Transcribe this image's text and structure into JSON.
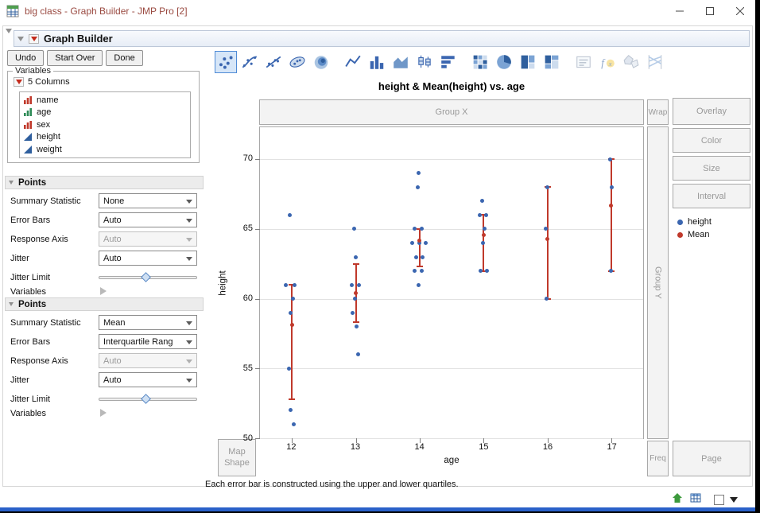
{
  "window": {
    "title": "big class - Graph Builder - JMP Pro [2]"
  },
  "report": {
    "header_title": "Graph Builder",
    "action_buttons": [
      "Undo",
      "Start Over",
      "Done"
    ]
  },
  "variables_panel": {
    "legend": "Variables",
    "columns_label": "5 Columns",
    "columns": [
      {
        "name": "name",
        "type": "nominal"
      },
      {
        "name": "age",
        "type": "ordinal"
      },
      {
        "name": "sex",
        "type": "nominal"
      },
      {
        "name": "height",
        "type": "continuous"
      },
      {
        "name": "weight",
        "type": "continuous"
      }
    ]
  },
  "field_labels": {
    "summary_statistic": "Summary Statistic",
    "error_bars": "Error Bars",
    "response_axis": "Response Axis",
    "jitter": "Jitter",
    "jitter_limit": "Jitter Limit",
    "variables": "Variables"
  },
  "points_panels": [
    {
      "title": "Points",
      "summary_statistic": "None",
      "error_bars": "Auto",
      "response_axis": "Auto",
      "jitter": "Auto"
    },
    {
      "title": "Points",
      "summary_statistic": "Mean",
      "error_bars": "Interquartile Rang",
      "response_axis": "Auto",
      "jitter": "Auto"
    }
  ],
  "toolbar_icons": [
    {
      "name": "points",
      "selected": true
    },
    {
      "name": "smoother"
    },
    {
      "name": "line-of-fit"
    },
    {
      "name": "ellipse"
    },
    {
      "name": "contour"
    },
    {
      "name": "line",
      "group": 2
    },
    {
      "name": "bar"
    },
    {
      "name": "area"
    },
    {
      "name": "box-plot"
    },
    {
      "name": "histogram"
    },
    {
      "name": "heatmap",
      "group": 3
    },
    {
      "name": "pie"
    },
    {
      "name": "treemap"
    },
    {
      "name": "mosaic"
    },
    {
      "name": "caption-box",
      "group": 4,
      "muted": true
    },
    {
      "name": "formula",
      "muted": true
    },
    {
      "name": "map-shapes",
      "muted": true
    },
    {
      "name": "parallel",
      "muted": true
    }
  ],
  "drop_zones": {
    "group_x": "Group X",
    "wrap": "Wrap",
    "overlay": "Overlay",
    "color": "Color",
    "size": "Size",
    "interval": "Interval",
    "group_y": "Group Y",
    "map_shape_line1": "Map",
    "map_shape_line2": "Shape",
    "freq": "Freq",
    "page": "Page"
  },
  "legend": {
    "items": [
      {
        "label": "height",
        "color": "#3b66b0"
      },
      {
        "label": "Mean",
        "color": "#c0392b"
      }
    ]
  },
  "chart_data": {
    "type": "scatter",
    "title": "height & Mean(height) vs. age",
    "xlabel": "age",
    "ylabel": "height",
    "x_categories": [
      "12",
      "13",
      "14",
      "15",
      "16",
      "17"
    ],
    "y_ticks": [
      50,
      55,
      60,
      65,
      70
    ],
    "ylim": [
      50,
      72.3
    ],
    "grid": "horizontal",
    "legend_position": "right",
    "series": [
      {
        "name": "height",
        "marker": "circle",
        "color": "#3b66b0",
        "points_by_age": {
          "12": [
            [
              66,
              -3
            ],
            [
              61,
              -8
            ],
            [
              61,
              3
            ],
            [
              60,
              1
            ],
            [
              59,
              -2
            ],
            [
              55,
              -4
            ],
            [
              52,
              -2
            ],
            [
              51,
              2
            ]
          ],
          "13": [
            [
              65,
              -2
            ],
            [
              63,
              0
            ],
            [
              61,
              4
            ],
            [
              61,
              -5
            ],
            [
              60,
              -1
            ],
            [
              59,
              -4
            ],
            [
              58,
              1
            ],
            [
              56,
              3
            ]
          ],
          "14": [
            [
              69,
              -1
            ],
            [
              68,
              -2
            ],
            [
              65,
              -6
            ],
            [
              65,
              3
            ],
            [
              64,
              -9
            ],
            [
              64,
              0
            ],
            [
              64,
              8
            ],
            [
              63,
              -4
            ],
            [
              63,
              4
            ],
            [
              62,
              -6
            ],
            [
              62,
              3
            ],
            [
              61,
              -1
            ]
          ],
          "15": [
            [
              67,
              -2
            ],
            [
              66,
              -5
            ],
            [
              66,
              3
            ],
            [
              65,
              1
            ],
            [
              64,
              -1
            ],
            [
              62,
              -4
            ],
            [
              62,
              4
            ]
          ],
          "16": [
            [
              68,
              0
            ],
            [
              65,
              -2
            ],
            [
              60,
              -1
            ]
          ],
          "17": [
            [
              70,
              -1
            ],
            [
              68,
              1
            ],
            [
              62,
              0
            ]
          ]
        }
      },
      {
        "name": "Mean",
        "marker": "circle",
        "color": "#c0392b",
        "means": [
          58.1,
          60.4,
          64.2,
          64.6,
          64.3,
          66.7
        ],
        "interquartile_bars": [
          [
            52.8,
            61
          ],
          [
            58.3,
            62.5
          ],
          [
            62.3,
            65
          ],
          [
            62,
            66
          ],
          [
            60,
            68
          ],
          [
            62,
            70
          ]
        ]
      }
    ]
  },
  "status_note": "Each error bar is constructed using the upper and lower quartiles."
}
